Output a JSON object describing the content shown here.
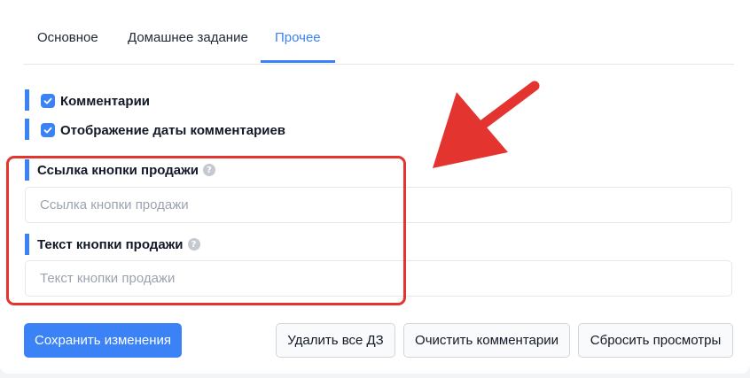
{
  "tabs": [
    {
      "label": "Основное",
      "active": false
    },
    {
      "label": "Домашнее задание",
      "active": false
    },
    {
      "label": "Прочее",
      "active": true
    }
  ],
  "checkboxes": [
    {
      "label": "Комментарии",
      "checked": true
    },
    {
      "label": "Отображение даты комментариев",
      "checked": true
    }
  ],
  "fields": {
    "sale_link": {
      "label": "Ссылка кнопки продажи",
      "value": "",
      "placeholder": "Ссылка кнопки продажи",
      "info_icon": "info-icon"
    },
    "sale_text": {
      "label": "Текст кнопки продажи",
      "value": "",
      "placeholder": "Текст кнопки продажи",
      "info_icon": "info-icon"
    }
  },
  "buttons": {
    "save": "Сохранить изменения",
    "delete_all_hw": "Удалить все ДЗ",
    "clear_comments": "Очистить комментарии",
    "reset_views": "Сбросить просмотры"
  },
  "colors": {
    "accent": "#3b82f6",
    "annotation": "#e3342f"
  }
}
